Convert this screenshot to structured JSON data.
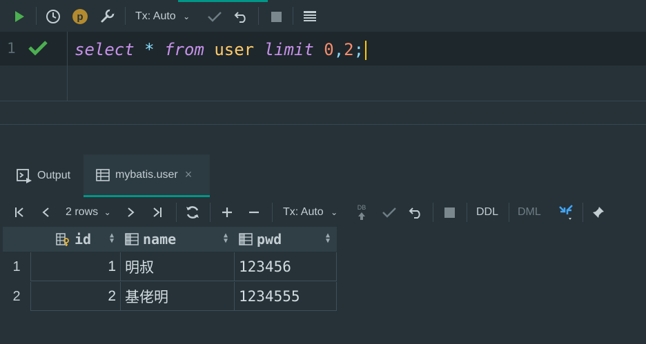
{
  "toolbar": {
    "tx_mode": "Tx: Auto",
    "badge_letter": "p"
  },
  "editor": {
    "line_number": "1",
    "code_tokens": {
      "k1": "select",
      "star": "*",
      "k2": "from",
      "table": "user",
      "k3": "limit",
      "n1": "0",
      "comma": ",",
      "n2": "2",
      "semi": ";"
    }
  },
  "tabs": {
    "output_label": "Output",
    "result_label": "mybatis.user",
    "close_glyph": "×"
  },
  "results_toolbar": {
    "rows_label": "2 rows",
    "tx_mode": "Tx: Auto",
    "db_label": "DB",
    "ddl_label": "DDL",
    "dml_label": "DML"
  },
  "table": {
    "columns": [
      "id",
      "name",
      "pwd"
    ],
    "rows": [
      {
        "num": "1",
        "id": "1",
        "name": "明叔",
        "pwd": "123456"
      },
      {
        "num": "2",
        "id": "2",
        "name": "基佬明",
        "pwd": "1234555"
      }
    ]
  },
  "colors": {
    "background": "#263238",
    "accent": "#009688",
    "run_green": "#4caf50",
    "keyword": "#c792ea",
    "identifier": "#ffcb6b",
    "number": "#f78c6c"
  }
}
